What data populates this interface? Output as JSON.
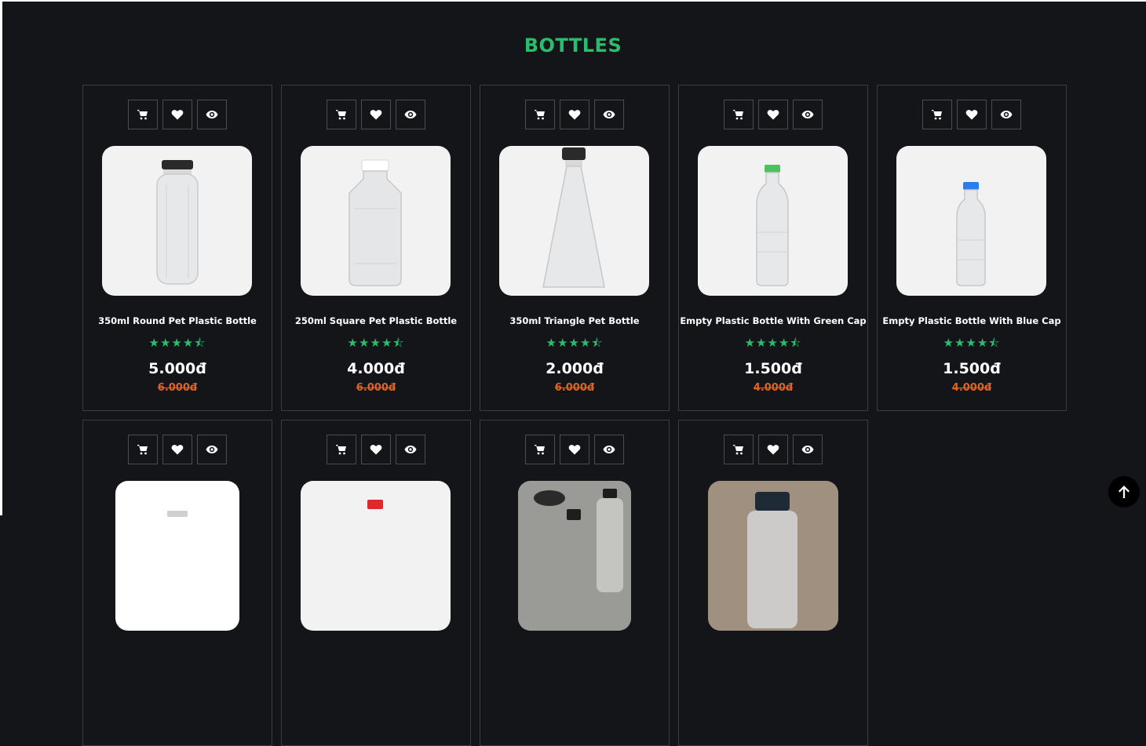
{
  "section": {
    "title": "BOTTLES"
  },
  "colors": {
    "accent": "#2bbd6e",
    "sale": "#e0621f",
    "background": "#141519"
  },
  "rating_stars": "★★★★⯪",
  "action_icons": [
    "cart-icon",
    "heart-icon",
    "eye-icon"
  ],
  "products": [
    {
      "name": "350ml Round Pet Plastic Bottle",
      "price": "5.000đ",
      "old_price": "6.000đ",
      "cap_color": "#2a2a2a"
    },
    {
      "name": "250ml Square Pet Plastic Bottle",
      "price": "4.000đ",
      "old_price": "6.000đ",
      "cap_color": "#ffffff"
    },
    {
      "name": "350ml Triangle Pet Bottle",
      "price": "2.000đ",
      "old_price": "6.000đ",
      "cap_color": "#2a2a2a"
    },
    {
      "name": "Empty Plastic Bottle With Green Cap",
      "price": "1.500đ",
      "old_price": "4.000đ",
      "cap_color": "#4cc35a"
    },
    {
      "name": "Empty Plastic Bottle With Blue Cap",
      "price": "1.500đ",
      "old_price": "4.000đ",
      "cap_color": "#2b7de9"
    },
    {
      "name": "",
      "price": "",
      "old_price": "",
      "cap_color": "#cfcfcf"
    },
    {
      "name": "",
      "price": "",
      "old_price": "",
      "cap_color": "#e0282b"
    },
    {
      "name": "",
      "price": "",
      "old_price": "",
      "cap_color": "#1e1e1e"
    },
    {
      "name": "",
      "price": "",
      "old_price": "",
      "cap_color": "#1e2a35"
    }
  ]
}
